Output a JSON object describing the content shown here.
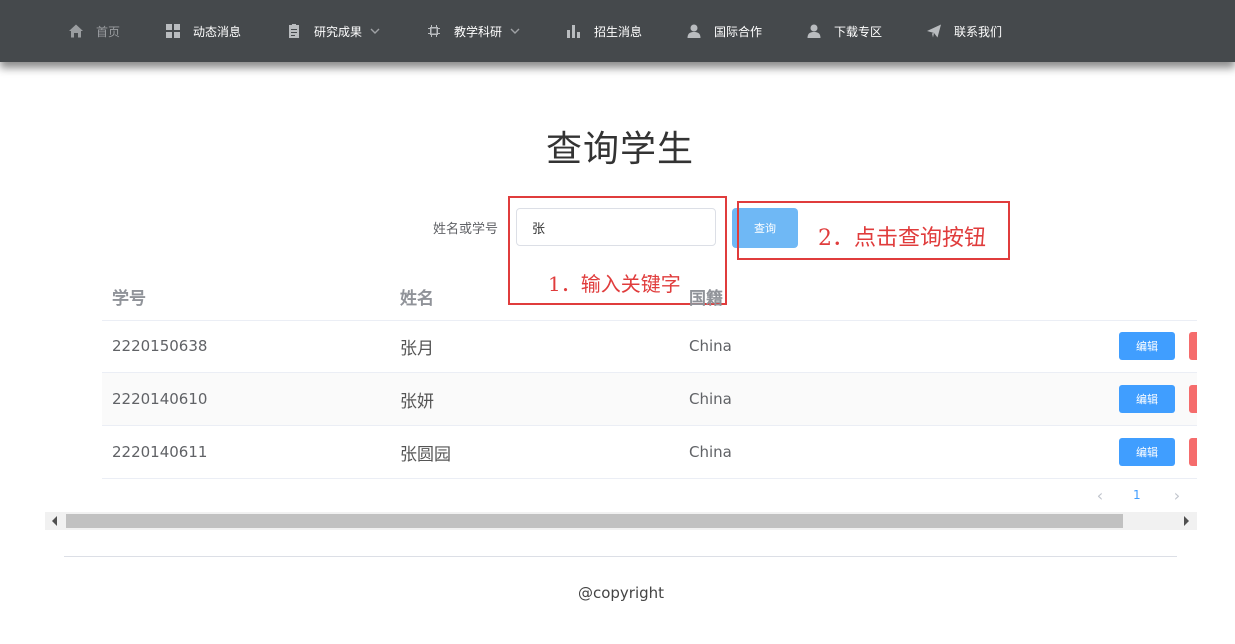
{
  "nav": {
    "items": [
      {
        "label": "首页",
        "icon": "home-icon",
        "active": true
      },
      {
        "label": "动态消息",
        "icon": "grid-icon"
      },
      {
        "label": "研究成果",
        "icon": "clipboard-icon",
        "dropdown": true
      },
      {
        "label": "教学科研",
        "icon": "chip-icon",
        "dropdown": true
      },
      {
        "label": "招生消息",
        "icon": "bar-chart-icon"
      },
      {
        "label": "国际合作",
        "icon": "user-icon"
      },
      {
        "label": "下载专区",
        "icon": "user-icon"
      },
      {
        "label": "联系我们",
        "icon": "send-icon"
      }
    ]
  },
  "page": {
    "title": "查询学生"
  },
  "search": {
    "label": "姓名或学号",
    "value": "张",
    "button": "查询"
  },
  "annotations": {
    "step1": "1．输入关键字",
    "step2": "2．点击查询按钮",
    "color": "#e03c3c"
  },
  "table": {
    "headers": [
      "学号",
      "姓名",
      "国籍"
    ],
    "rows": [
      {
        "id": "2220150638",
        "name": "张月",
        "country": "China"
      },
      {
        "id": "2220140610",
        "name": "张妍",
        "country": "China"
      },
      {
        "id": "2220140611",
        "name": "张圆园",
        "country": "China"
      }
    ],
    "edit_label": "编辑"
  },
  "pagination": {
    "current": "1"
  },
  "footer": {
    "copyright": "@copyright"
  },
  "colors": {
    "nav_bg": "#45494c",
    "primary": "#409eff",
    "danger": "#f56c6c"
  }
}
